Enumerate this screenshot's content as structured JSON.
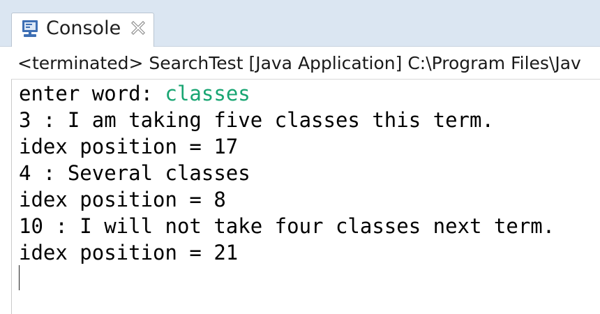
{
  "tab": {
    "icon": "console-monitor-icon",
    "label": "Console",
    "close_icon": "close-x-icon",
    "colors": {
      "tabbar_bg": "#dbe6f2",
      "icon_blue": "#3e6fb4"
    }
  },
  "status": {
    "text": "<terminated> SearchTest [Java Application] C:\\Program Files\\Jav"
  },
  "console": {
    "input_color": "#18a572",
    "prompt": "enter word: ",
    "user_input": "classes",
    "lines": [
      "3 : I am taking five classes this term.",
      "idex position = 17",
      "4 : Several classes",
      "idex position = 8",
      "10 : I will not take four classes next term.",
      "idex position = 21"
    ]
  }
}
